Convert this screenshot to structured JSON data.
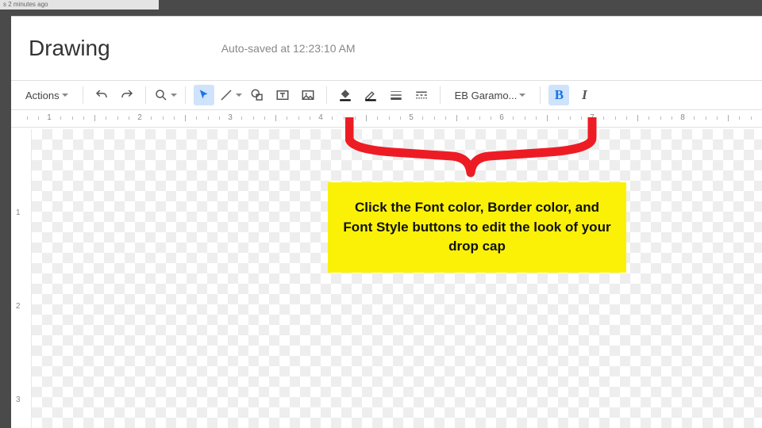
{
  "browser_tab": "s 2 minutes ago",
  "header": {
    "title": "Drawing",
    "autosave": "Auto-saved at 12:23:10 AM"
  },
  "toolbar": {
    "actions": "Actions",
    "font_name": "EB Garamo...",
    "bold": "B",
    "italic": "I"
  },
  "ruler_h": [
    "1",
    "2",
    "3",
    "4",
    "5",
    "6",
    "7",
    "8"
  ],
  "ruler_v": [
    "1",
    "2",
    "3"
  ],
  "callout": "Click the Font color, Border color, and Font Style buttons to edit the look of your drop cap"
}
